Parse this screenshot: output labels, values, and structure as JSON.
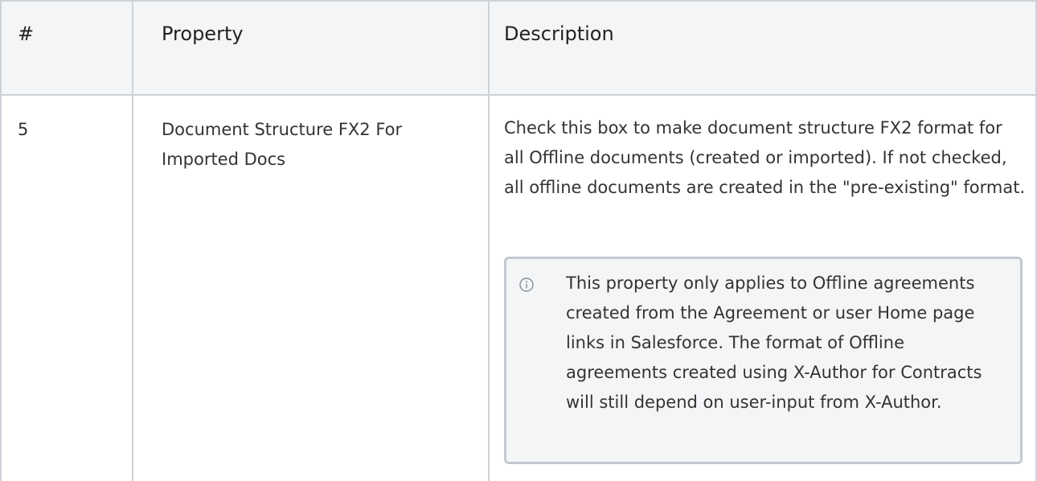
{
  "table": {
    "headers": [
      "#",
      "Property",
      "Description"
    ],
    "rows": [
      {
        "number": "5",
        "property": "Document Structure FX2 For Imported Docs",
        "description": "Check this box to make document structure FX2 format for all Offline documents (created or imported). If not checked, all offline documents are created in the \"pre-existing\" format.",
        "note": {
          "icon": "info-icon",
          "text": "This property only applies to Offline agreements created from the Agreement or user Home page links in Salesforce. The format of Offline agreements created using X-Author for Contracts will still depend on user-input from X-Author."
        }
      }
    ]
  },
  "colors": {
    "border": "#cdd2d8",
    "header_bg": "#f4f5f7",
    "note_border": "#c3c9d1",
    "text": "#333333"
  }
}
